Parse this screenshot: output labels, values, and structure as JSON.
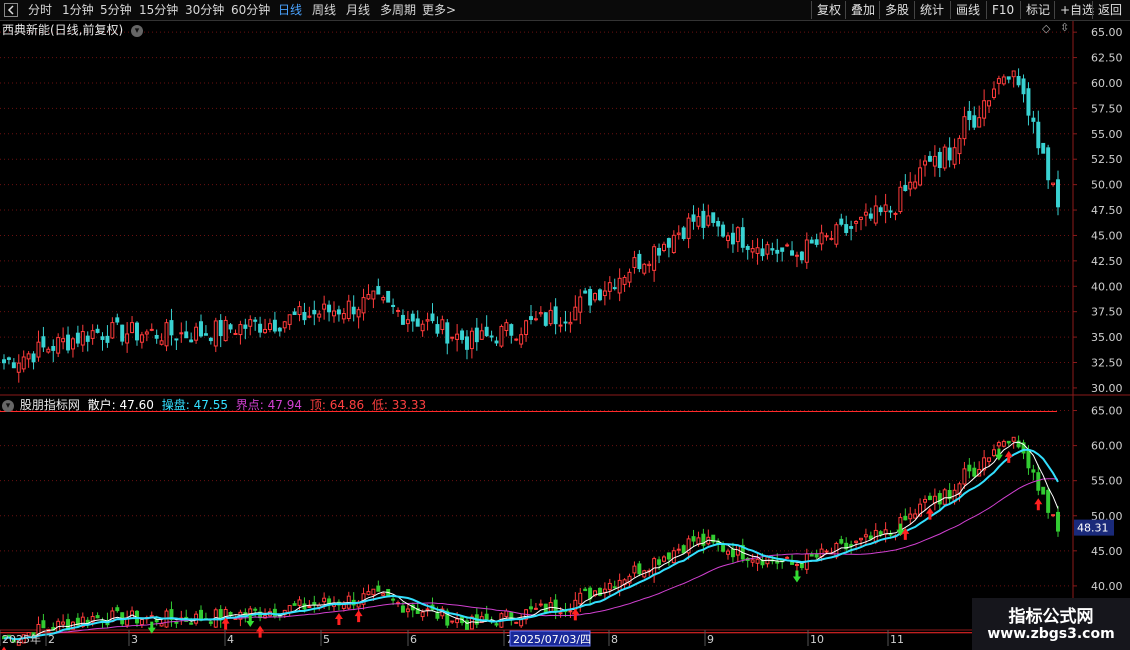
{
  "toolbar": {
    "periods": [
      "分时",
      "1分钟",
      "5分钟",
      "15分钟",
      "30分钟",
      "60分钟",
      "日线",
      "周线",
      "月线",
      "多周期",
      "更多"
    ],
    "active_period": "日线",
    "more_arrow": ">",
    "right_buttons": [
      "复权",
      "叠加",
      "多股",
      "统计",
      "画线",
      "F10",
      "标记",
      "+自选",
      "返回"
    ]
  },
  "main_chart": {
    "title": "西典新能(日线,前复权)",
    "y_ticks": [
      "65.00",
      "62.50",
      "60.00",
      "57.50",
      "55.00",
      "52.50",
      "50.00",
      "47.50",
      "45.00",
      "42.50",
      "40.00",
      "37.50",
      "35.00",
      "32.50",
      "30.00"
    ],
    "diamond": "◇"
  },
  "indicator": {
    "name": "股朋指标网",
    "retail_label": "散户:",
    "retail_value": "47.60",
    "operator_label": "操盘:",
    "operator_value": "47.55",
    "boundary_label": "界点:",
    "boundary_value": "47.94",
    "top_label": "顶:",
    "top_value": "64.86",
    "low_label": "低:",
    "low_value": "33.33",
    "y_ticks": [
      "65.00",
      "60.00",
      "55.00",
      "50.00",
      "45.00",
      "40.00"
    ],
    "current_price_tag": "48.31"
  },
  "x_axis": {
    "labels": [
      "2025年",
      "2",
      "3",
      "4",
      "5",
      "6",
      "7",
      "8",
      "9",
      "10",
      "11"
    ],
    "cursor_date": "2025/07/03/四"
  },
  "watermark": {
    "line1": "指标公式网",
    "line2": "www.zbgs3.com"
  },
  "chart_data": {
    "type": "candlestick",
    "title": "西典新能(日线,前复权)",
    "y_range_main": [
      29.5,
      66
    ],
    "y_range_indicator": [
      34,
      66.5
    ],
    "series": [
      {
        "name": "散户",
        "last": 47.6
      },
      {
        "name": "操盘",
        "last": 47.55
      },
      {
        "name": "界点",
        "last": 47.94
      }
    ],
    "key_levels": {
      "top": 64.86,
      "low": 33.33
    },
    "months": [
      "2025年",
      "2",
      "3",
      "4",
      "5",
      "6",
      "7",
      "8",
      "9",
      "10",
      "11"
    ],
    "close_path": [
      {
        "month": "2025年",
        "close": 32.5
      },
      {
        "month": "2",
        "close": 35.5
      },
      {
        "month": "3",
        "close": 35.3
      },
      {
        "month": "4",
        "close": 36.5
      },
      {
        "month": "5",
        "close": 38.5
      },
      {
        "month": "6",
        "close": 34.5
      },
      {
        "month": "7",
        "close": 37.5
      },
      {
        "month": "8",
        "close": 46.5
      },
      {
        "month": "9",
        "close": 43.0
      },
      {
        "month": "10",
        "close": 47.5
      },
      {
        "month": "11",
        "close": 62.5
      },
      {
        "month": "end",
        "close": 47.6
      }
    ],
    "colors": {
      "up": "#ff3b3b",
      "down": "#39d2d2",
      "retail": "#ffffff",
      "operator": "#33e0ff",
      "boundary": "#d040d0"
    }
  }
}
